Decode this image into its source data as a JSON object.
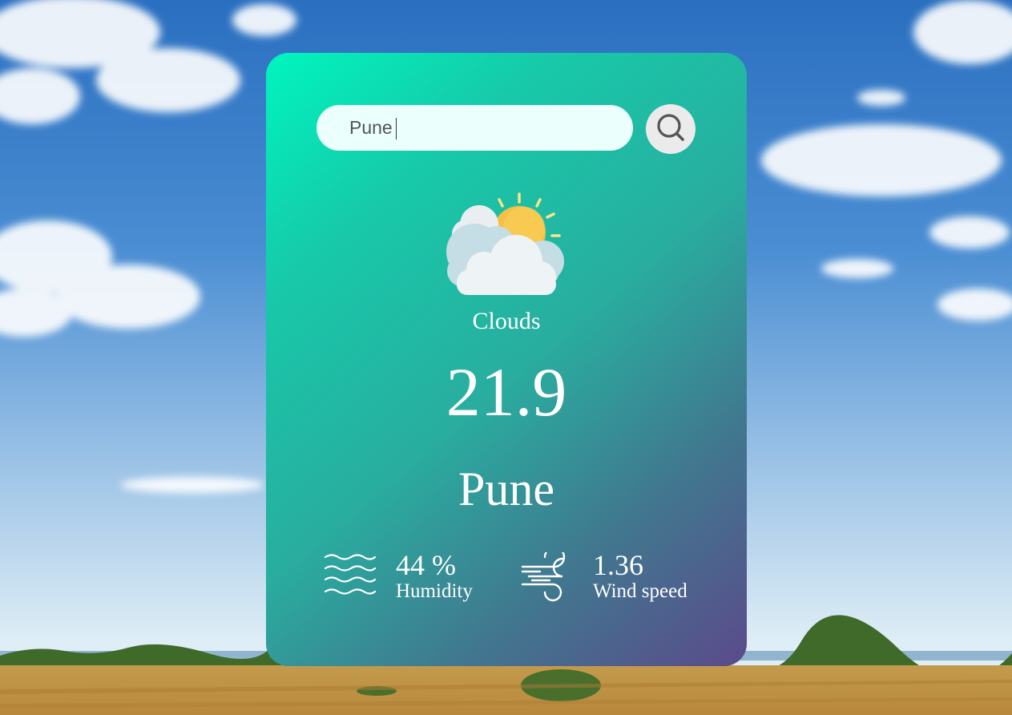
{
  "search": {
    "value": "Pune",
    "button_icon": "search-icon"
  },
  "weather": {
    "icon": "sun-behind-clouds-icon",
    "condition": "Clouds",
    "temperature": "21.9",
    "city": "Pune"
  },
  "details": {
    "humidity": {
      "icon": "waves-icon",
      "value": "44 %",
      "label": "Humidity"
    },
    "wind": {
      "icon": "wind-icon",
      "value": "1.36",
      "label": "Wind speed"
    }
  },
  "colors": {
    "card_gradient_start": "#00f5bf",
    "card_gradient_end": "#5b4a8b",
    "input_background": "#ebfffc",
    "button_background": "#ebebeb",
    "text": "#ffffff"
  }
}
